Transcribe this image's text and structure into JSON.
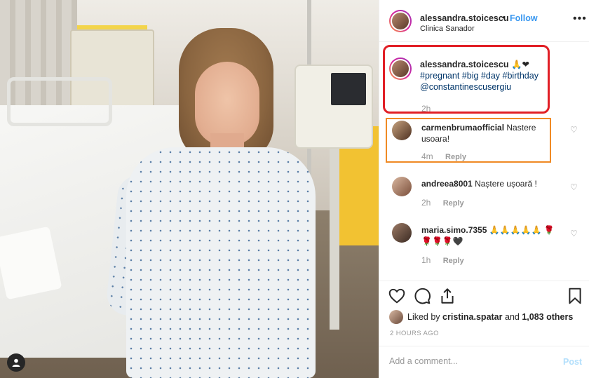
{
  "post": {
    "username": "alessandra.stoicescu",
    "separator": "•",
    "follow_label": "Follow",
    "location": "Clinica Sanador",
    "more_label": "•••"
  },
  "caption": {
    "username": "alessandra.stoicescu",
    "emoji": "🙏❤",
    "tags": [
      "#pregnant",
      "#big",
      "#day",
      "#birthday"
    ],
    "mention": "@constantinescusergiu",
    "time": "2h"
  },
  "comments": [
    {
      "username": "carmenbrumaofficial",
      "text": "Nastere usoara!",
      "time": "4m",
      "reply": "Reply"
    },
    {
      "username": "andreea8001",
      "text": "Naștere ușoară !",
      "time": "2h",
      "reply": "Reply"
    },
    {
      "username": "maria.simo.7355",
      "text": "🙏🙏🙏🙏🙏 🌹🌹🌹🌹🖤",
      "time": "1h",
      "reply": "Reply"
    }
  ],
  "likes": {
    "prefix": "Liked by",
    "user": "cristina.spatar",
    "middle": "and",
    "count": "1,083 others"
  },
  "timestamp": "2 HOURS AGO",
  "add_comment": {
    "placeholder": "Add a comment...",
    "post_label": "Post"
  },
  "icons": {
    "like": "heart-icon",
    "comment": "comment-icon",
    "share": "share-icon",
    "save": "bookmark-icon",
    "comment_like": "heart-icon",
    "tagged_user": "user-icon"
  },
  "colors": {
    "follow": "#3897f0",
    "hashtag": "#003569",
    "highlight_caption": "#e11f26",
    "highlight_comment": "#f08a24",
    "muted": "#999999"
  }
}
